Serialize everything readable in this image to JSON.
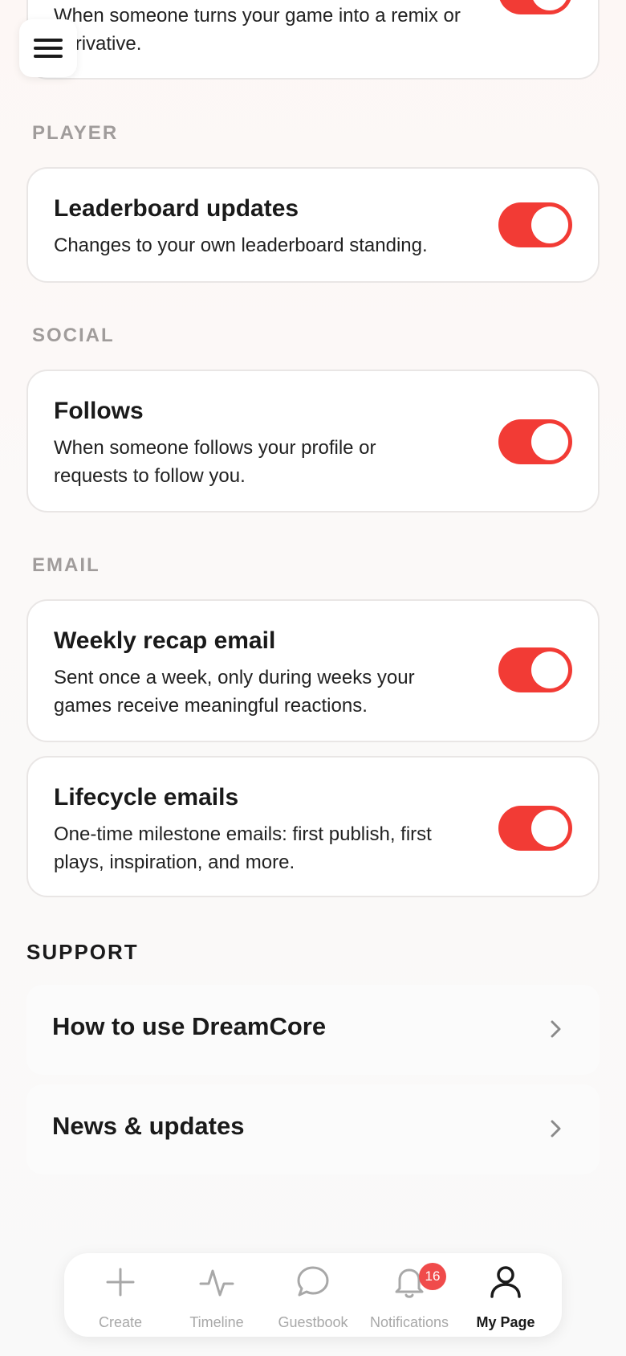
{
  "top_card": {
    "desc": "When someone turns your game into a remix or derivative."
  },
  "sections": {
    "player": "PLAYER",
    "social": "SOCIAL",
    "email": "EMAIL",
    "support": "SUPPORT"
  },
  "settings": {
    "leaderboard": {
      "title": "Leaderboard updates",
      "desc": "Changes to your own leaderboard standing.",
      "enabled": true
    },
    "follows": {
      "title": "Follows",
      "desc": "When someone follows your profile or requests to follow you.",
      "enabled": true
    },
    "weekly_recap": {
      "title": "Weekly recap email",
      "desc": "Sent once a week, only during weeks your games receive meaningful reactions.",
      "enabled": true
    },
    "lifecycle": {
      "title": "Lifecycle emails",
      "desc": "One-time milestone emails: first publish, first plays, inspiration, and more.",
      "enabled": true
    }
  },
  "support": {
    "how_to": "How to use DreamCore",
    "news": "News & updates"
  },
  "tabs": {
    "create": "Create",
    "timeline": "Timeline",
    "guestbook": "Guestbook",
    "notifications": "Notifications",
    "notifications_badge": "16",
    "my_page": "My Page"
  },
  "colors": {
    "accent": "#f23b35",
    "badge": "#f04b4b"
  },
  "icons": [
    "menu-icon",
    "plus-icon",
    "activity-icon",
    "chat-bubble-icon",
    "bell-icon",
    "user-icon",
    "chevron-right-icon"
  ]
}
